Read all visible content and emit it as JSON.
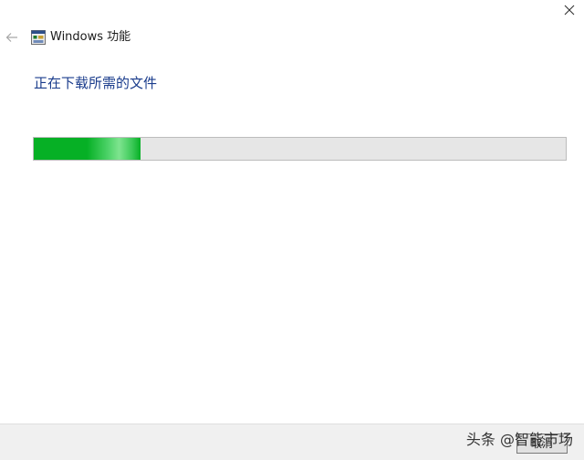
{
  "window": {
    "title": "Windows 功能",
    "close_icon": "close-icon",
    "back_icon": "back-arrow-icon",
    "app_icon": "windows-features-icon"
  },
  "main": {
    "heading": "正在下载所需的文件",
    "progress": {
      "fraction": 0.2,
      "color": "#06b025"
    }
  },
  "footer": {
    "cancel_label": "取消"
  },
  "watermark": "头条 @智能市场",
  "colors": {
    "heading": "#1a3c8c",
    "progress_fill": "#06b025",
    "progress_track": "#e6e6e6"
  }
}
